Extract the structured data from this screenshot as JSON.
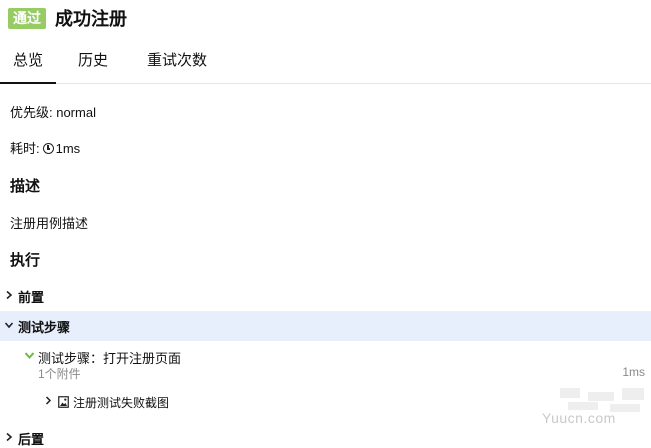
{
  "header": {
    "status_badge": "通过",
    "title": "成功注册"
  },
  "tabs": [
    {
      "label": "总览",
      "active": true
    },
    {
      "label": "历史",
      "active": false
    },
    {
      "label": "重试次数",
      "active": false
    }
  ],
  "overview": {
    "priority_line": "优先级: normal",
    "duration_label": "耗时:",
    "duration_value": "1ms"
  },
  "description": {
    "heading": "描述",
    "text": "注册用例描述"
  },
  "execution": {
    "heading": "执行",
    "stages": [
      {
        "label": "前置",
        "expanded": false
      },
      {
        "label": "测试步骤",
        "expanded": true
      },
      {
        "label": "后置",
        "expanded": false
      }
    ],
    "step": {
      "label": "测试步骤：打开注册页面",
      "attachment_count": "1个附件",
      "duration": "1ms",
      "status": "passed",
      "attachment": {
        "label": "注册测试失败截图",
        "icon": "image-file-icon"
      }
    }
  },
  "watermark": {
    "text": "Yuucn.com"
  },
  "colors": {
    "passed": "#97cc64",
    "selected_row": "#e7eefc",
    "check": "#6dbb3c"
  }
}
